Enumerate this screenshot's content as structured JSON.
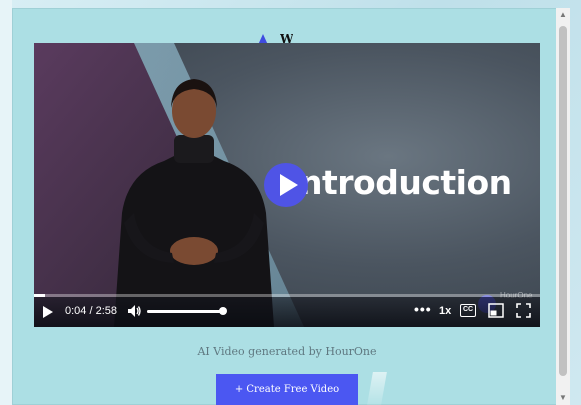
{
  "logo": {
    "text": "W"
  },
  "video": {
    "slide_title": "ntroduction",
    "time_display": "0:04 / 2:58",
    "progress_fraction": 0.022,
    "volume_fraction": 1.0,
    "speed_label": "1x",
    "cc_label": "CC",
    "more_label": "•••",
    "watermark": "HourOne"
  },
  "caption": "AI Video generated by HourOne",
  "cta": {
    "label": "+ Create Free Video"
  },
  "icons": {
    "play": "play-icon",
    "volume": "volume-icon",
    "more": "more-icon",
    "cc": "cc-icon",
    "pip": "picture-in-picture-icon",
    "fullscreen": "fullscreen-icon"
  },
  "colors": {
    "accent": "#4b57f2",
    "panel": "#acdfe4"
  }
}
